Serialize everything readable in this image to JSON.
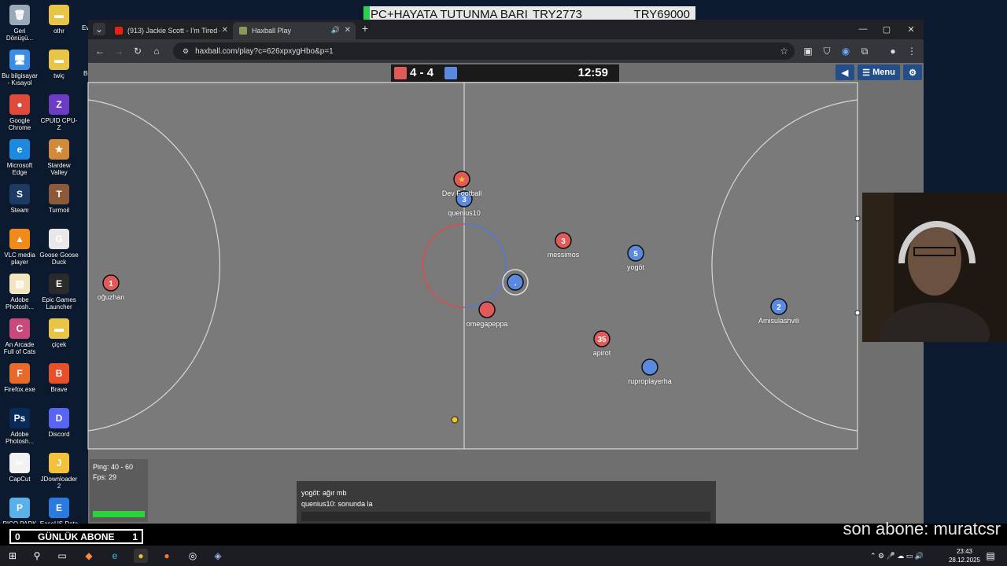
{
  "desktop": {
    "icons": [
      {
        "label": "Geri Dönüşü...",
        "color": "#9aa9b8",
        "glyph": "🗑"
      },
      {
        "label": "othr",
        "color": "#e8c547",
        "glyph": "▬"
      },
      {
        "label": "Bu bilgisayar - Kısayol",
        "color": "#3a8ee6",
        "glyph": "🖥"
      },
      {
        "label": "twiç",
        "color": "#e8c547",
        "glyph": "▬"
      },
      {
        "label": "Google Chrome",
        "color": "#e04a3a",
        "glyph": "●"
      },
      {
        "label": "CPUID CPU-Z",
        "color": "#6c3cc2",
        "glyph": "Z"
      },
      {
        "label": "Microsoft Edge",
        "color": "#1c8adf",
        "glyph": "e"
      },
      {
        "label": "Stardew Valley",
        "color": "#d08a3a",
        "glyph": "★"
      },
      {
        "label": "Steam",
        "color": "#1b3b63",
        "glyph": "S"
      },
      {
        "label": "Turmoil",
        "color": "#8a5a3a",
        "glyph": "T"
      },
      {
        "label": "VLC media player",
        "color": "#f08a1a",
        "glyph": "▲"
      },
      {
        "label": "Goose Goose Duck",
        "color": "#e8e8e8",
        "glyph": "G"
      },
      {
        "label": "Adobe Photosh...",
        "color": "#f2e6c0",
        "glyph": "▤"
      },
      {
        "label": "Epic Games Launcher",
        "color": "#2a2a2a",
        "glyph": "E"
      },
      {
        "label": "An Arcade Full of Cats",
        "color": "#c84a7a",
        "glyph": "C"
      },
      {
        "label": "çiçek",
        "color": "#e8c547",
        "glyph": "▬"
      },
      {
        "label": "Firefox.exe",
        "color": "#e86a2a",
        "glyph": "F"
      },
      {
        "label": "Brave",
        "color": "#e8502a",
        "glyph": "B"
      },
      {
        "label": "Adobe Photosh...",
        "color": "#0a2a5a",
        "glyph": "Ps"
      },
      {
        "label": "Discord",
        "color": "#5865f2",
        "glyph": "D"
      },
      {
        "label": "CapCut",
        "color": "#f2f2f2",
        "glyph": "✂"
      },
      {
        "label": "JDownloader 2",
        "color": "#f2c23a",
        "glyph": "J"
      },
      {
        "label": "PICO PARK",
        "color": "#5ab0e8",
        "glyph": "P"
      },
      {
        "label": "EaseUS Data",
        "color": "#2a7ae0",
        "glyph": "E"
      }
    ],
    "partial_labels": [
      "Ev",
      "Bi"
    ]
  },
  "donation": {
    "left": "PC+HAYATA TUTUNMA BARI",
    "middle": "TRY2773",
    "right": "TRY69000"
  },
  "browser": {
    "tabs": [
      {
        "label": "(913) Jackie Scott - I'm Tired - Y",
        "favicon_color": "#e62117"
      },
      {
        "label": "Haxball Play",
        "favicon_color": "#8a9a5a"
      }
    ],
    "url": "haxball.com/play?c=626xpxygHbo&p=1",
    "new_tab_label": "+"
  },
  "game": {
    "red_score": "4",
    "blue_score": "4",
    "score_separator": "-",
    "time": "12:59",
    "menu_label": "Menu",
    "players": [
      {
        "name": "oğuzhan",
        "number": "1",
        "team": "red"
      },
      {
        "name": "Dev Football",
        "number": "",
        "team": "red",
        "star": true
      },
      {
        "name": "quenius10",
        "number": "3",
        "team": "blue"
      },
      {
        "name": "messimos",
        "number": "3",
        "team": "red"
      },
      {
        "name": "yogöt",
        "number": "5",
        "team": "blue"
      },
      {
        "name": "omegapeppa",
        "number": "",
        "team": "red"
      },
      {
        "name": "",
        "number": ".",
        "team": "blue",
        "highlight": true
      },
      {
        "name": "apirot",
        "number": "35",
        "team": "red"
      },
      {
        "name": "ruproplayerha",
        "number": "",
        "team": "blue"
      },
      {
        "name": "Amisulashvili",
        "number": "2",
        "team": "blue"
      }
    ],
    "team_colors": {
      "red": "#e05a5a",
      "blue": "#5a89e0"
    },
    "ball_color": "#f2c623",
    "ping_label": "Ping: 40 - 60",
    "fps_label": "Fps: 29"
  },
  "chat": {
    "messages": [
      {
        "text": "yogöt: ağır mb"
      },
      {
        "text": "quenius10: sonunda la"
      }
    ]
  },
  "overlay": {
    "abone_left": "0",
    "abone_title": "GÜNLÜK ABONE",
    "abone_right": "1",
    "last_sub": "son abone: muratcsr"
  },
  "taskbar": {
    "time": "23:43",
    "date": "28.12.2025"
  }
}
